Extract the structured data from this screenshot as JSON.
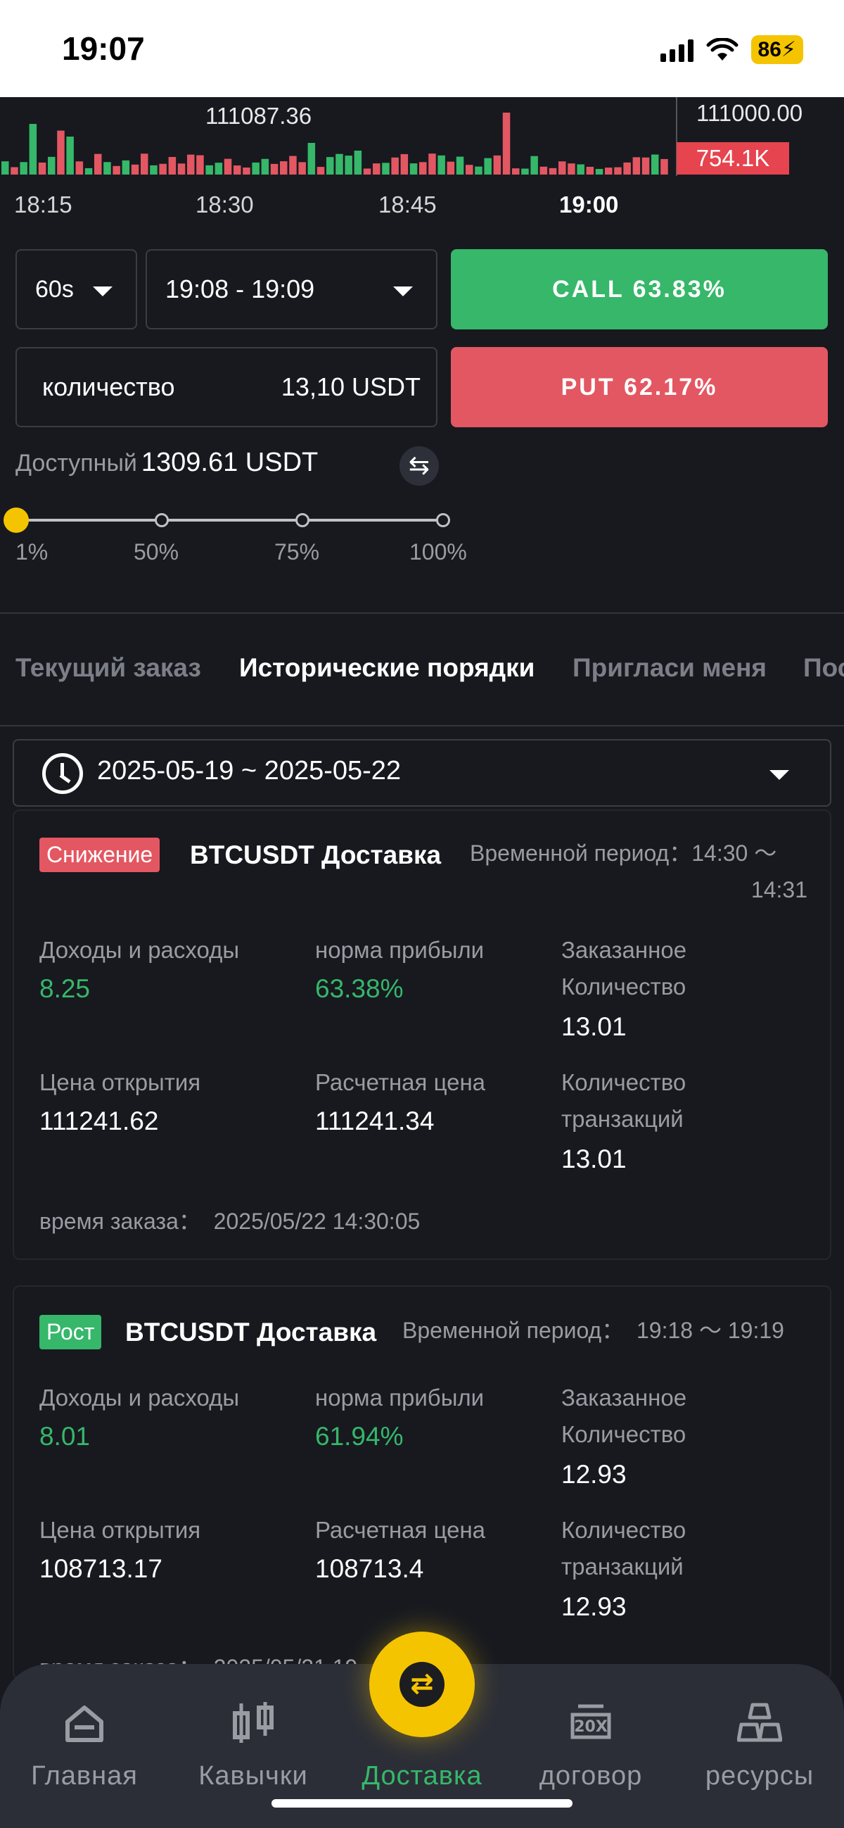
{
  "status": {
    "time": "19:07",
    "battery": "86"
  },
  "chart": {
    "price_mid": "111087.36",
    "price_right": "111000.00",
    "volume_badge": "754.1K",
    "time_labels": [
      "18:15",
      "18:30",
      "18:45",
      "19:00"
    ]
  },
  "controls": {
    "interval": "60s",
    "time_range": "19:08 - 19:09",
    "quantity_label": "количество",
    "quantity_value": "13,10 USDT",
    "call_label": "CALL 63.83%",
    "put_label": "PUT 62.17%",
    "available_label": "Доступный",
    "available_value": "1309.61 USDT",
    "slider_level_percent": 1,
    "slider_marks": [
      "1%",
      "50%",
      "75%",
      "100%"
    ]
  },
  "tabs": [
    "Текущий заказ",
    "Исторические порядки",
    "Пригласи меня",
    "Пос"
  ],
  "date_range": "2025-05-19 ~ 2025-05-22",
  "labels": {
    "pnl": "Доходы и расходы",
    "profit_rate": "норма прибыли",
    "ordered_qty_1": "Заказанное",
    "ordered_qty_2": "Количество",
    "open_price": "Цена открытия",
    "settle_price": "Расчетная цена",
    "tx_qty_1": "Количество",
    "tx_qty_2": "транзакций"
  },
  "orders": [
    {
      "direction": "Снижение",
      "pair": "BTCUSDT Доставка",
      "period_label": "Временной период：",
      "period_start": "14:30 ～",
      "period_end": "14:31",
      "pnl": "8.25",
      "profit_rate": "63.38%",
      "ordered_qty": "13.01",
      "open_price": "111241.62",
      "settle_price": "111241.34",
      "tx_qty": "13.01",
      "order_time": "время заказа：  2025/05/22 14:30:05"
    },
    {
      "direction": "Рост",
      "pair": "BTCUSDT Доставка",
      "period": "Временной период：  19:18 ～ 19:19",
      "pnl": "8.01",
      "profit_rate": "61.94%",
      "ordered_qty": "12.93",
      "open_price": "108713.17",
      "settle_price": "108713.4",
      "tx_qty": "12.93",
      "order_time": "время заказа：  2025/05/21 19"
    }
  ],
  "nav": [
    "Главная",
    "Кавычки",
    "Доставка",
    "договор",
    "ресурсы"
  ],
  "colors": {
    "green": "#36b76a",
    "red": "#e35762",
    "yellow": "#f5c400",
    "bg": "#17191f"
  }
}
